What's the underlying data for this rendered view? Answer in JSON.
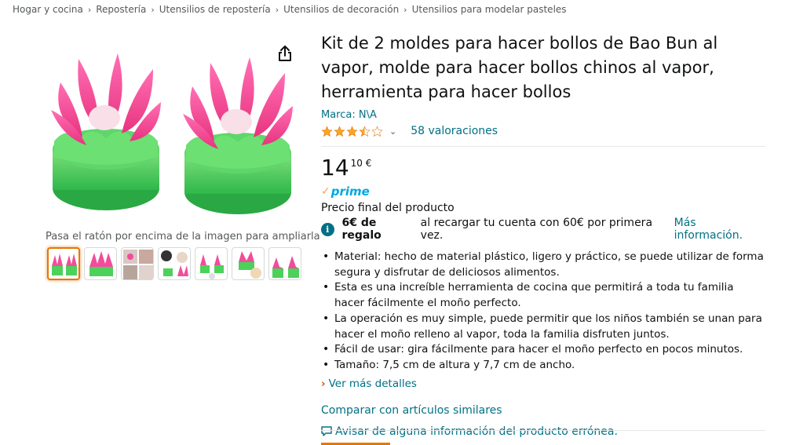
{
  "breadcrumb": [
    "Hogar y cocina",
    "Repostería",
    "Utensilios de repostería",
    "Utensilios de decoración",
    "Utensilios para modelar pasteles"
  ],
  "breadcrumb_separator": "›",
  "gallery": {
    "hover_hint": "Pasa el ratón por encima de la imagen para ampliarla",
    "thumbnail_count": 7,
    "selected_index": 0
  },
  "product": {
    "title": "Kit de 2 moldes para hacer bollos de Bao Bun al vapor, molde para hacer bollos chinos al vapor, herramienta para hacer bollos",
    "brand": "Marca: N\\A",
    "rating_stars": 3.5,
    "ratings_count": "58 valoraciones",
    "price_whole": "14",
    "price_fraction": "10 €",
    "prime_label": "prime",
    "final_price_label": "Precio final del producto",
    "promo": {
      "bold": "6€ de regalo",
      "text": "al recargar tu cuenta con 60€ por primera vez.",
      "link": "Más información."
    },
    "bullets": [
      "Material: hecho de material plástico, ligero y práctico, se puede utilizar de forma segura y disfrutar de deliciosos alimentos.",
      "Esta es una increíble herramienta de cocina que permitirá a toda tu familia hacer fácilmente el moño perfecto.",
      "La operación es muy simple, puede permitir que los niños también se unan para hacer el moño relleno al vapor, toda la familia disfruten juntos.",
      "Fácil de usar: gira fácilmente para hacer el moño perfecto en pocos minutos.",
      "Tamaño: 7,5 cm de altura y 7,7 cm de ancho."
    ],
    "see_more": "Ver más detalles",
    "compare": "Comparar con artículos similares",
    "report": "Avisar de alguna información del producto errónea."
  },
  "colors": {
    "link": "#007185",
    "star": "#ffa41c",
    "prime_blue": "#00a8e1",
    "selected_thumb": "#e77600",
    "mold_green": "#4cd15a",
    "mold_pink": "#f24c9c"
  },
  "icons": {
    "share": "share-icon",
    "info": "info-icon",
    "report": "chat-bubble-icon"
  }
}
